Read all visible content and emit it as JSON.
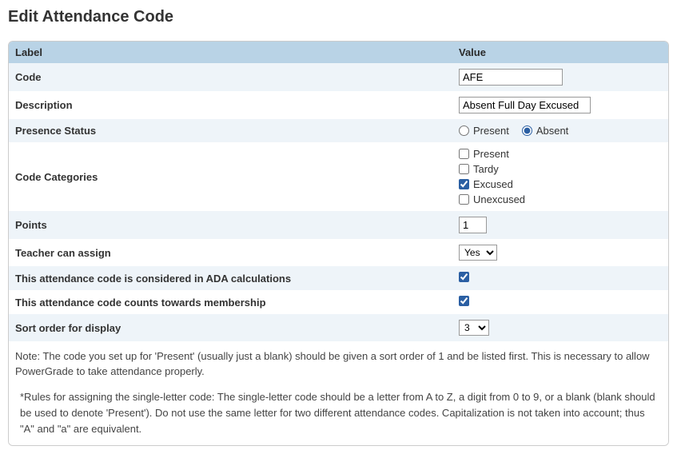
{
  "page_title": "Edit Attendance Code",
  "headers": {
    "label": "Label",
    "value": "Value"
  },
  "fields": {
    "code": {
      "label": "Code",
      "value": "AFE"
    },
    "description": {
      "label": "Description",
      "value": "Absent Full Day Excused"
    },
    "presence_status": {
      "label": "Presence Status",
      "options": {
        "present": "Present",
        "absent": "Absent"
      },
      "selected": "absent"
    },
    "code_categories": {
      "label": "Code Categories",
      "options": {
        "present": {
          "label": "Present",
          "checked": false
        },
        "tardy": {
          "label": "Tardy",
          "checked": false
        },
        "excused": {
          "label": "Excused",
          "checked": true
        },
        "unexcused": {
          "label": "Unexcused",
          "checked": false
        }
      }
    },
    "points": {
      "label": "Points",
      "value": "1"
    },
    "teacher_can_assign": {
      "label": "Teacher can assign",
      "value": "Yes"
    },
    "ada": {
      "label": "This attendance code is considered in ADA calculations",
      "checked": true
    },
    "membership": {
      "label": "This attendance code counts towards membership",
      "checked": true
    },
    "sort_order": {
      "label": "Sort order for display",
      "value": "3"
    }
  },
  "note": "Note: The code you set up for 'Present' (usually just a blank) should be given a sort order of 1 and be listed first. This is necessary to allow PowerGrade to take attendance properly.",
  "rules": "*Rules for assigning the single-letter code: The single-letter code should be a letter from A to Z, a digit from 0 to 9, or a blank (blank should be used to denote 'Present'). Do not use the same letter for two different attendance codes. Capitalization is not taken into account; thus \"A\" and \"a\" are equivalent."
}
